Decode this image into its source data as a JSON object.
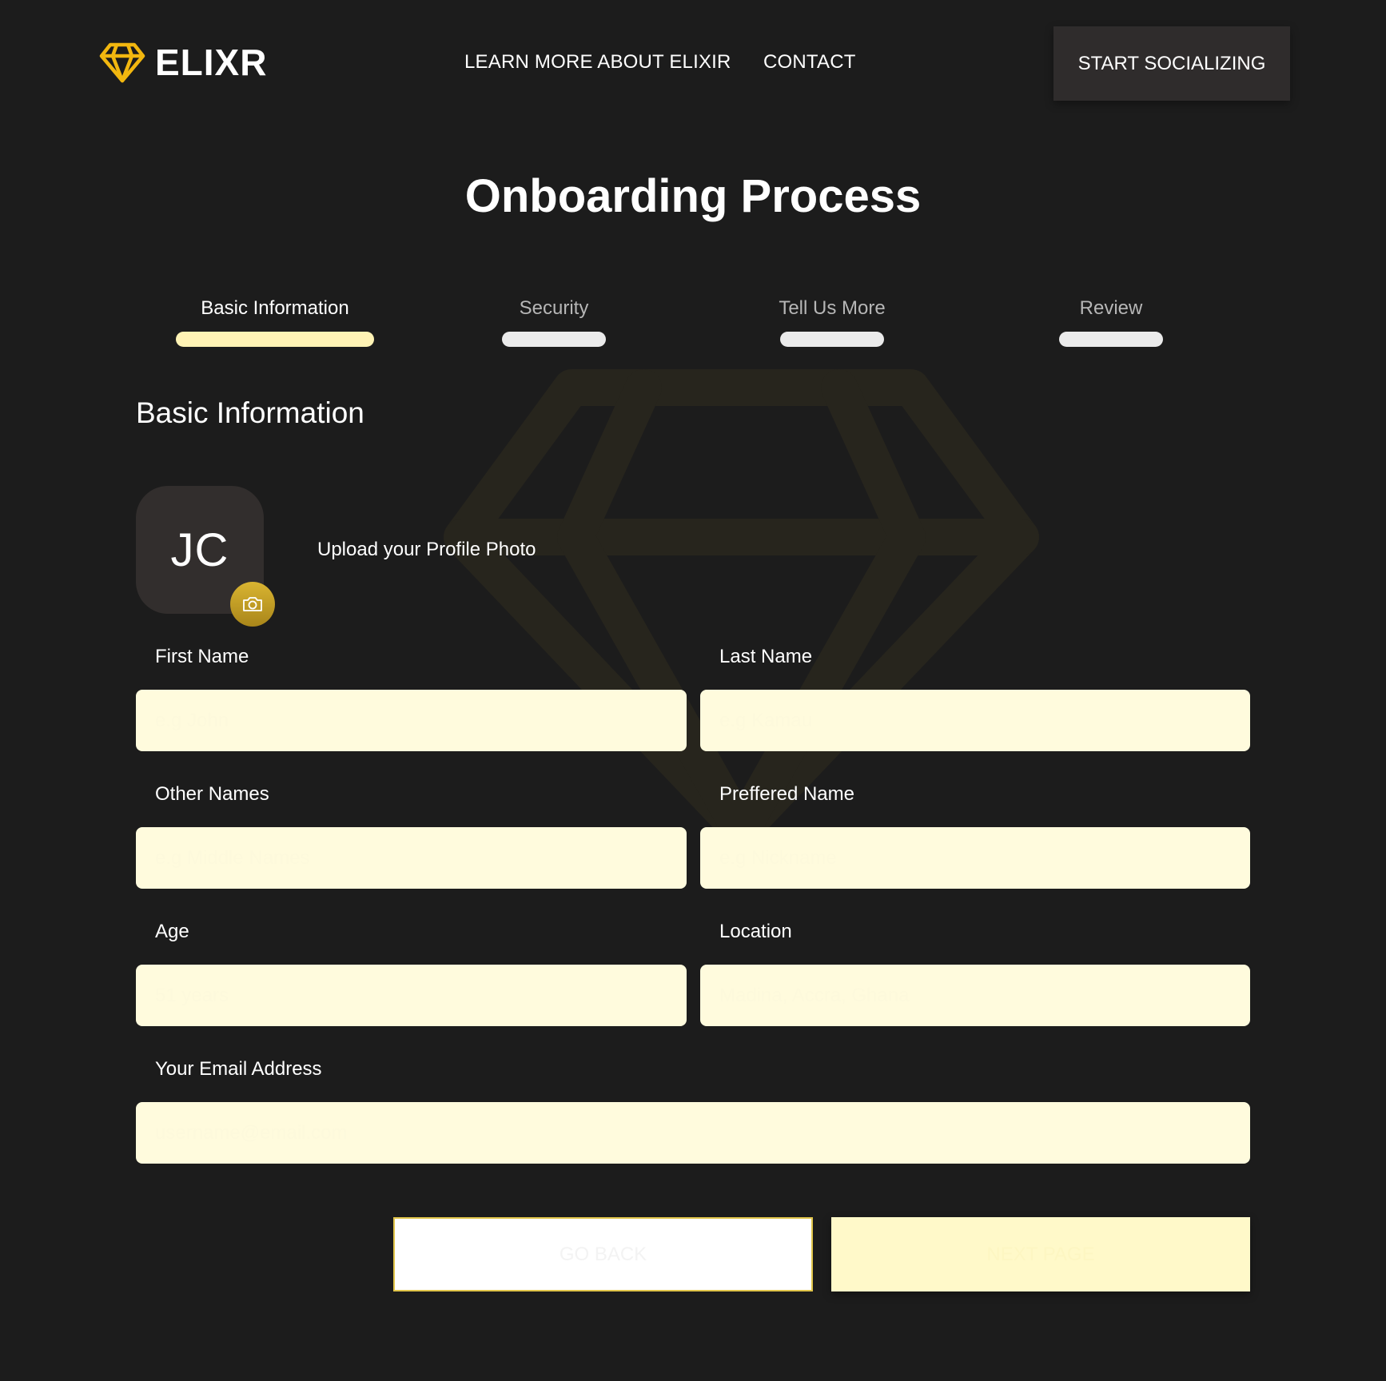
{
  "header": {
    "brand": "ELIXR",
    "nav": [
      {
        "label": "LEARN MORE ABOUT ELIXIR"
      },
      {
        "label": "CONTACT"
      }
    ],
    "cta_label": "START SOCIALIZING"
  },
  "title": "Onboarding Process",
  "steps": [
    {
      "label": "Basic Information",
      "active": true
    },
    {
      "label": "Security",
      "active": false
    },
    {
      "label": "Tell Us More",
      "active": false
    },
    {
      "label": "Review",
      "active": false
    }
  ],
  "section": {
    "heading": "Basic Information"
  },
  "avatar": {
    "initials": "JC",
    "upload_label": "Upload your Profile Photo"
  },
  "form": {
    "first_name": {
      "label": "First Name",
      "placeholder": "e.g John"
    },
    "last_name": {
      "label": "Last Name",
      "placeholder": "e.g Kamau"
    },
    "other_names": {
      "label": "Other Names",
      "placeholder": "e.g Middle Names"
    },
    "preferred_name": {
      "label": "Preffered Name",
      "placeholder": "e.g Nickname"
    },
    "age": {
      "label": "Age",
      "placeholder": "51 years"
    },
    "location": {
      "label": "Location",
      "placeholder": "Madina, Accra, Ghana"
    },
    "email": {
      "label": "Your Email Address",
      "placeholder": "username@email.com"
    }
  },
  "actions": {
    "back_label": "GO BACK",
    "next_label": "NEXT PAGE"
  },
  "colors": {
    "background": "#1c1c1c",
    "accent_gold": "#f2b70f",
    "input_bg": "#fffbdd",
    "active_step": "#fff3b5",
    "inactive_step": "#ebebeb",
    "cta_bg": "#2f2c2c"
  },
  "icons": {
    "logo": "diamond-icon",
    "avatar_upload": "camera-icon",
    "watermark": "diamond-icon"
  }
}
